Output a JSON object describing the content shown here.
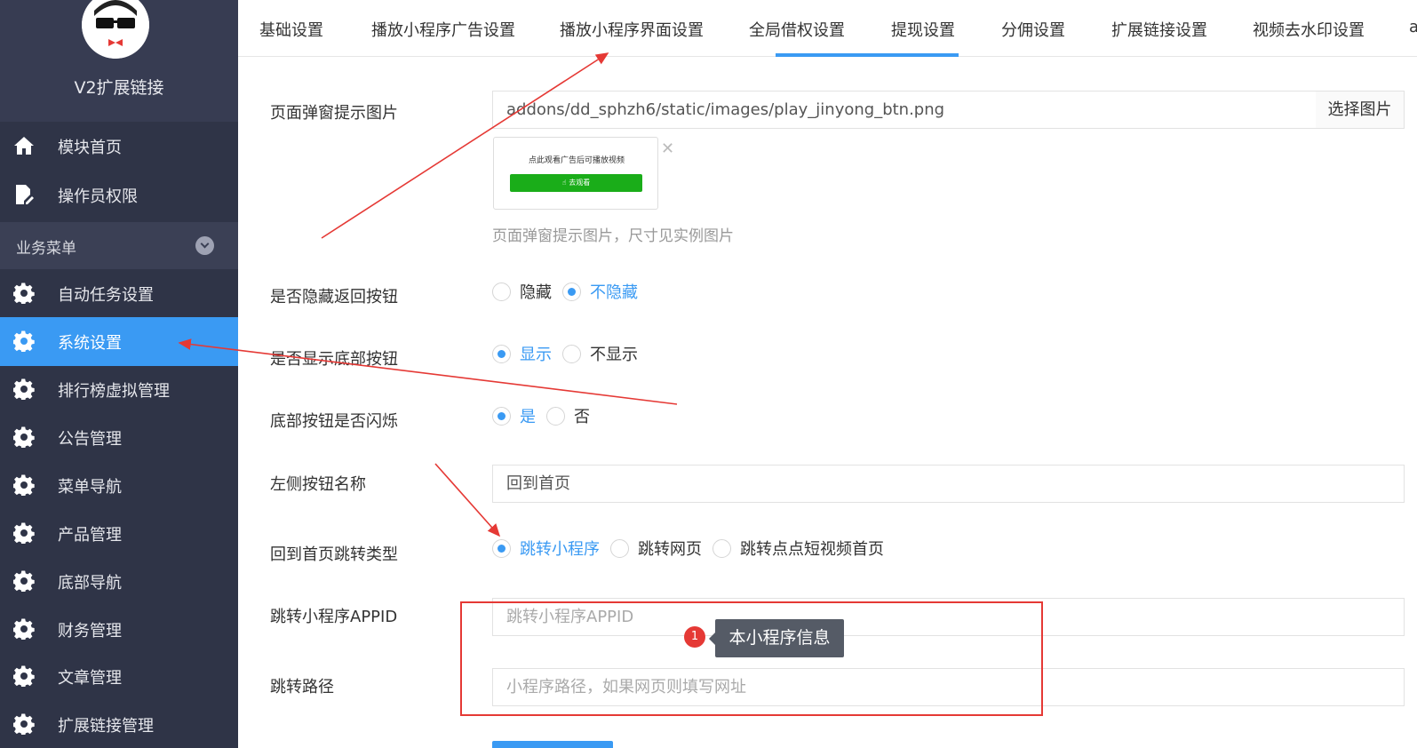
{
  "sidebar": {
    "brand_title": "V2扩展链接",
    "items_top": [
      {
        "label": "模块首页",
        "icon": "home-icon"
      },
      {
        "label": "操作员权限",
        "icon": "document-edit-icon"
      }
    ],
    "section_label": "业务菜单",
    "items": [
      {
        "label": "自动任务设置",
        "icon": "gear-icon"
      },
      {
        "label": "系统设置",
        "icon": "gear-icon",
        "active": true
      },
      {
        "label": "排行榜虚拟管理",
        "icon": "gear-icon"
      },
      {
        "label": "公告管理",
        "icon": "gear-icon"
      },
      {
        "label": "菜单导航",
        "icon": "gear-icon"
      },
      {
        "label": "产品管理",
        "icon": "gear-icon"
      },
      {
        "label": "底部导航",
        "icon": "gear-icon"
      },
      {
        "label": "财务管理",
        "icon": "gear-icon"
      },
      {
        "label": "文章管理",
        "icon": "gear-icon"
      },
      {
        "label": "扩展链接管理",
        "icon": "gear-icon"
      }
    ]
  },
  "tabs": [
    {
      "label": "基础设置"
    },
    {
      "label": "播放小程序广告设置"
    },
    {
      "label": "播放小程序界面设置",
      "active": true
    },
    {
      "label": "全局借权设置"
    },
    {
      "label": "提现设置"
    },
    {
      "label": "分佣设置"
    },
    {
      "label": "扩展链接设置"
    },
    {
      "label": "视频去水印设置"
    },
    {
      "label": "a"
    }
  ],
  "form": {
    "popup_image": {
      "label": "页面弹窗提示图片",
      "value": "addons/dd_sphzh6/static/images/play_jinyong_btn.png",
      "select_button": "选择图片",
      "preview_text": "点此观看广告后可播放视频",
      "preview_button": "去观看",
      "help": "页面弹窗提示图片，尺寸见实例图片"
    },
    "hide_back": {
      "label": "是否隐藏返回按钮",
      "options": [
        "隐藏",
        "不隐藏"
      ],
      "selected": 1
    },
    "show_bottom": {
      "label": "是否显示底部按钮",
      "options": [
        "显示",
        "不显示"
      ],
      "selected": 0
    },
    "bottom_flash": {
      "label": "底部按钮是否闪烁",
      "options": [
        "是",
        "否"
      ],
      "selected": 0
    },
    "left_button_name": {
      "label": "左侧按钮名称",
      "value": "回到首页"
    },
    "home_jump_type": {
      "label": "回到首页跳转类型",
      "options": [
        "跳转小程序",
        "跳转网页",
        "跳转点点短视频首页"
      ],
      "selected": 0
    },
    "jump_appid": {
      "label": "跳转小程序APPID",
      "placeholder": "跳转小程序APPID"
    },
    "jump_path": {
      "label": "跳转路径",
      "placeholder": "小程序路径，如果网页则填写网址"
    }
  },
  "annotation": {
    "badge": "1",
    "tooltip": "本小程序信息",
    "color": "#e53935"
  },
  "colors": {
    "sidebar_bg": "#2f3447",
    "accent": "#3a9af3"
  }
}
